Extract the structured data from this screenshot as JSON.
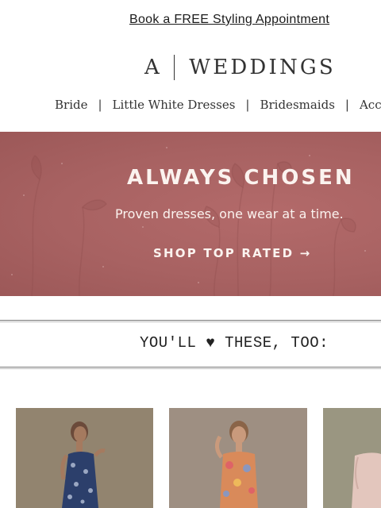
{
  "promo": {
    "link_label": "Book a FREE Styling Appointment"
  },
  "logo": {
    "mark": "A",
    "wordmark": "WEDDINGS"
  },
  "nav": {
    "items": [
      {
        "label": "Bride"
      },
      {
        "label": "Little White Dresses"
      },
      {
        "label": "Bridesmaids"
      },
      {
        "label": "Acces"
      }
    ],
    "separator": "|"
  },
  "hero": {
    "title": "ALWAYS CHOSEN",
    "subtitle": "Proven dresses, one wear at a time.",
    "cta_label": "SHOP TOP RATED →",
    "background_color": "#a86262"
  },
  "recommendations": {
    "heading": "YOU'LL ♥ THESE, TOO:"
  },
  "products": [
    {
      "image": "model-blue-floral-dress"
    },
    {
      "image": "model-orange-floral-dress"
    },
    {
      "image": "model-blush-dress"
    }
  ]
}
